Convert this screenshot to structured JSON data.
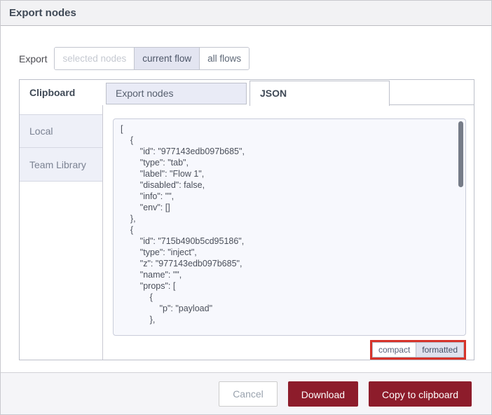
{
  "dialog": {
    "title": "Export nodes"
  },
  "export_row": {
    "label": "Export",
    "options": [
      {
        "label": "selected nodes",
        "state": "disabled"
      },
      {
        "label": "current flow",
        "state": "selected"
      },
      {
        "label": "all flows",
        "state": "normal"
      }
    ]
  },
  "library": {
    "heading": "Clipboard",
    "tabs": [
      {
        "label": "Export nodes",
        "active": false
      },
      {
        "label": "JSON",
        "active": true
      }
    ],
    "sidebar_items": [
      {
        "label": "Local"
      },
      {
        "label": "Team Library"
      }
    ]
  },
  "editor": {
    "json_code": "[\n    {\n        \"id\": \"977143edb097b685\",\n        \"type\": \"tab\",\n        \"label\": \"Flow 1\",\n        \"disabled\": false,\n        \"info\": \"\",\n        \"env\": []\n    },\n    {\n        \"id\": \"715b490b5cd95186\",\n        \"type\": \"inject\",\n        \"z\": \"977143edb097b685\",\n        \"name\": \"\",\n        \"props\": [\n            {\n                \"p\": \"payload\"\n            },",
    "format_toggle": {
      "compact_label": "compact",
      "formatted_label": "formatted",
      "selected": "formatted"
    }
  },
  "footer": {
    "cancel_label": "Cancel",
    "download_label": "Download",
    "copy_label": "Copy to clipboard"
  },
  "colors": {
    "primary_red": "#8d1c2b",
    "highlight_red": "#d6332a",
    "lavender_selected": "#e3e5f1",
    "tab_inactive_bg": "#e9ebf6",
    "sidebar_item_bg": "#eef0f8",
    "code_bg": "#f7f8fd"
  }
}
